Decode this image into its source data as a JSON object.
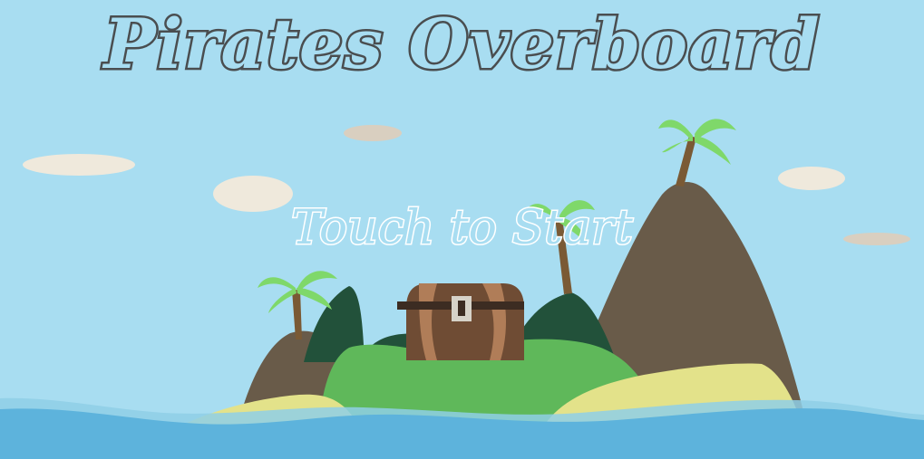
{
  "game": {
    "title": "Pirates Overboard",
    "prompt": "Touch to Start"
  },
  "colors": {
    "sky": "#a8ddf1",
    "cloud_light": "#efe9dc",
    "cloud_shadow": "#d9cfc0",
    "mountain": "#695b49",
    "hill_dark": "#22513a",
    "grass": "#5fb85a",
    "sand": "#e3e28a",
    "water": "#5db3dc",
    "chest_wood": "#6f4c34",
    "chest_band": "#b07d58",
    "palm_leaf": "#7fd86a",
    "title_outline": "#4a4e50",
    "prompt_outline": "#ffffff"
  },
  "icons": [
    "treasure-chest-icon",
    "palm-tree-icon"
  ]
}
